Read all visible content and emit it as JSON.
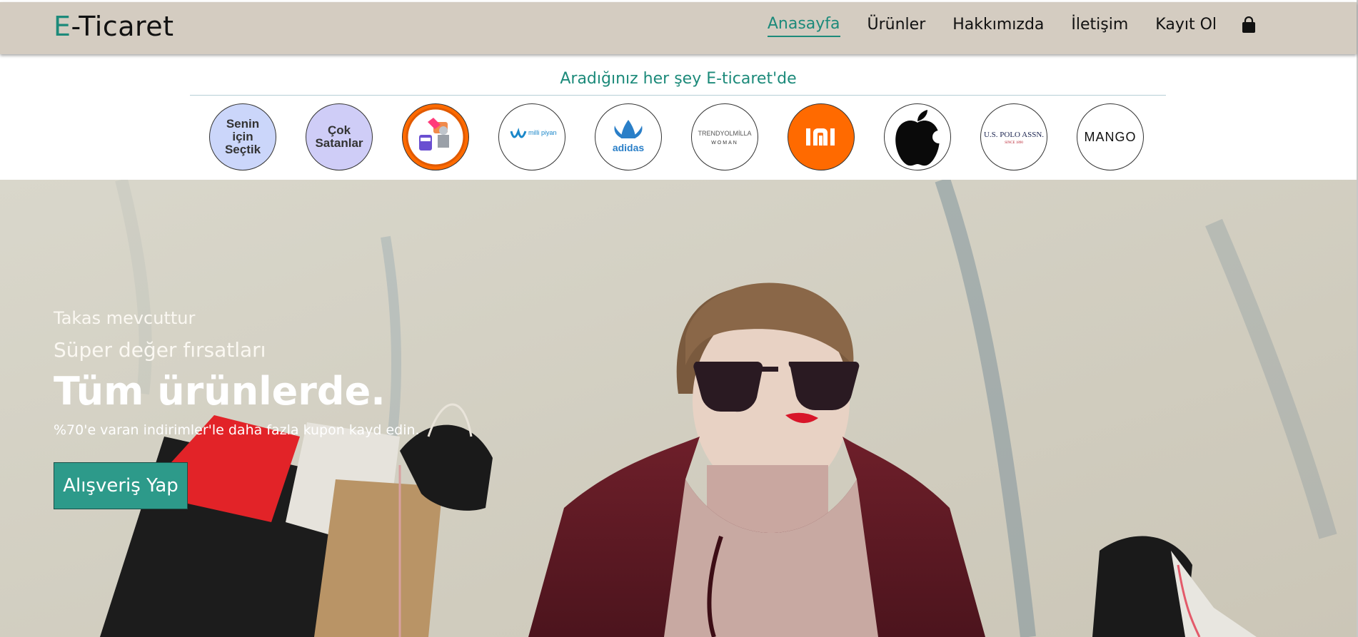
{
  "header": {
    "logo_prefix": "E",
    "logo_suffix": "-Ticaret",
    "nav": [
      {
        "label": "Anasayfa",
        "active": true
      },
      {
        "label": "Ürünler",
        "active": false
      },
      {
        "label": "Hakkımızda",
        "active": false
      },
      {
        "label": "İletişim",
        "active": false
      },
      {
        "label": "Kayıt Ol",
        "active": false
      }
    ],
    "cart_icon": "shopping-bag-icon"
  },
  "tagline": "Aradığınız her şey E-ticaret'de",
  "brands": [
    {
      "name": "Senin için Seçtik",
      "text": "Senin için Seçtik"
    },
    {
      "name": "Çok Satanlar",
      "text": "Çok Satanlar"
    },
    {
      "name": "gaming-accessories",
      "icon": "gaming-chair-icon"
    },
    {
      "name": "milli-piyango",
      "text": "milli piyango"
    },
    {
      "name": "adidas",
      "text": "adidas"
    },
    {
      "name": "trendyol-milla-woman",
      "text": "TRENDYOLMİLLA",
      "sub": "WOMAN"
    },
    {
      "name": "xiaomi",
      "text": "mi"
    },
    {
      "name": "apple",
      "icon": "apple-icon"
    },
    {
      "name": "us-polo-assn",
      "text": "U.S. POLO ASSN.",
      "sub": "SINCE 1890"
    },
    {
      "name": "mango",
      "text": "MANGO"
    }
  ],
  "hero": {
    "line1": "Takas mevcuttur",
    "line2": "Süper değer fırsatları",
    "headline": "Tüm ürünlerde.",
    "subtext": "%70'e varan indirimler'le daha fazla kupon kayd edin.",
    "cta_label": "Alışveriş Yap"
  },
  "colors": {
    "accent": "#1c8a7a",
    "header_bg": "#d4ccc1",
    "cta_bg": "#2d9a8a"
  }
}
